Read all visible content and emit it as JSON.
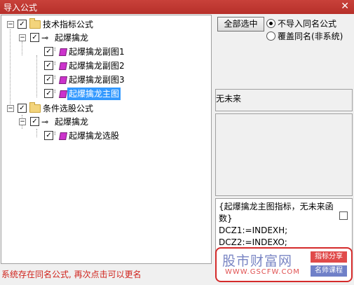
{
  "window": {
    "title": "导入公式",
    "close_glyph": "✕"
  },
  "tree": {
    "groups": [
      {
        "label": "技术指标公式",
        "formula": "起爆擒龙",
        "items": [
          "起爆擒龙副图1",
          "起爆擒龙副图2",
          "起爆擒龙副图3",
          "起爆擒龙主图"
        ],
        "selected_index": 3
      },
      {
        "label": "条件选股公式",
        "formula": "起爆擒龙",
        "items": [
          "起爆擒龙选股"
        ]
      }
    ]
  },
  "actions": {
    "select_all": "全部选中",
    "radio_options": [
      {
        "label": "不导入同名公式",
        "checked": true
      },
      {
        "label": "覆盖同名(非系统)",
        "checked": false
      }
    ]
  },
  "info": {
    "future_text": "无未来"
  },
  "code": {
    "text": "{起爆擒龙主图指标，无未来函数}\nDCZ1:=INDEXH;\nDCZ2:=INDEXO;"
  },
  "status": {
    "message": "系统存在同名公式, 再次点击可以更名"
  },
  "watermark": {
    "name": "股市财富网",
    "url": "WWW.GSCFW.COM",
    "tag1": "指标分享",
    "tag2": "名师课程"
  }
}
